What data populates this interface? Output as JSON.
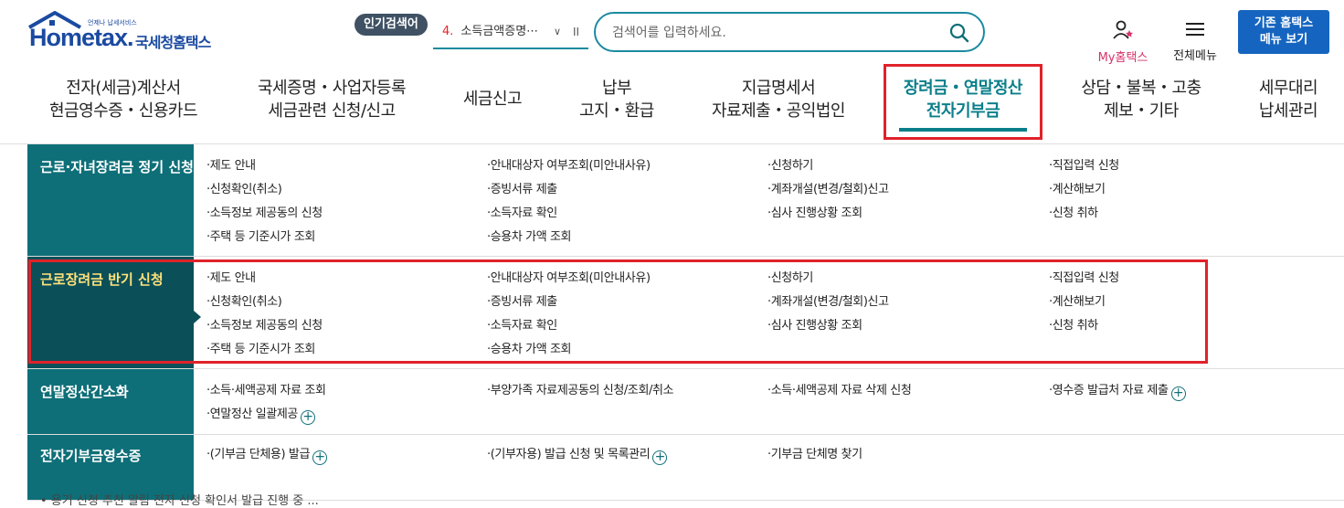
{
  "header": {
    "logo_text": "Hometax.",
    "logo_sub": "언제나 납세서비스",
    "logo_kr": "국세청홈택스",
    "popular_label": "인기검색어",
    "popular_item_num": "4.",
    "popular_item_text": "소득금액증명⋯",
    "search_placeholder": "검색어를 입력하세요.",
    "my_hometax": "My홈택스",
    "all_menu": "전체메뉴",
    "classic_btn_line1": "기존 홈택스",
    "classic_btn_line2": "메뉴 보기"
  },
  "gnb": [
    {
      "line1": "전자(세금)계산서",
      "line2": "현금영수증・신용카드"
    },
    {
      "line1": "국세증명・사업자등록",
      "line2": "세금관련 신청/신고"
    },
    {
      "line1": "세금신고",
      "line2": ""
    },
    {
      "line1": "납부",
      "line2": "고지・환급"
    },
    {
      "line1": "지급명세서",
      "line2": "자료제출・공익법인"
    },
    {
      "line1": "장려금・연말정산",
      "line2": "전자기부금"
    },
    {
      "line1": "상담・불복・고충",
      "line2": "제보・기타"
    },
    {
      "line1": "세무대리",
      "line2": "납세관리"
    }
  ],
  "mega": [
    {
      "head": "근로·자녀장려금 정기 신청",
      "links": [
        "·제도 안내",
        "·안내대상자 여부조회(미안내사유)",
        "·신청하기",
        "·직접입력 신청",
        "·신청확인(취소)",
        "·증빙서류 제출",
        "·계좌개설(변경/철회)신고",
        "·계산해보기",
        "·소득정보 제공동의 신청",
        "·소득자료 확인",
        "·심사 진행상황 조회",
        "·신청 취하",
        "·주택 등 기준시가 조회",
        "·승용차 가액 조회"
      ]
    },
    {
      "head": "근로장려금 반기 신청",
      "links": [
        "·제도 안내",
        "·안내대상자 여부조회(미안내사유)",
        "·신청하기",
        "·직접입력 신청",
        "·신청확인(취소)",
        "·증빙서류 제출",
        "·계좌개설(변경/철회)신고",
        "·계산해보기",
        "·소득정보 제공동의 신청",
        "·소득자료 확인",
        "·심사 진행상황 조회",
        "·신청 취하",
        "·주택 등 기준시가 조회",
        "·승용차 가액 조회"
      ]
    },
    {
      "head": "연말정산간소화",
      "links": [
        "·소득·세액공제 자료 조회",
        "·부양가족 자료제공동의 신청/조회/취소",
        "·소득·세액공제 자료 삭제 신청",
        "·영수증 발급처 자료 제출",
        "·연말정산 일괄제공"
      ]
    },
    {
      "head": "전자기부금영수증",
      "links": [
        "·(기부금 단체용) 발급",
        "·(기부자용) 발급 신청 및 목록관리",
        "·기부금 단체명 찾기"
      ]
    }
  ],
  "bottom_text": "• 용기 신청 추천 알림 전자 신청 확인서 발급 진행 중 ..."
}
